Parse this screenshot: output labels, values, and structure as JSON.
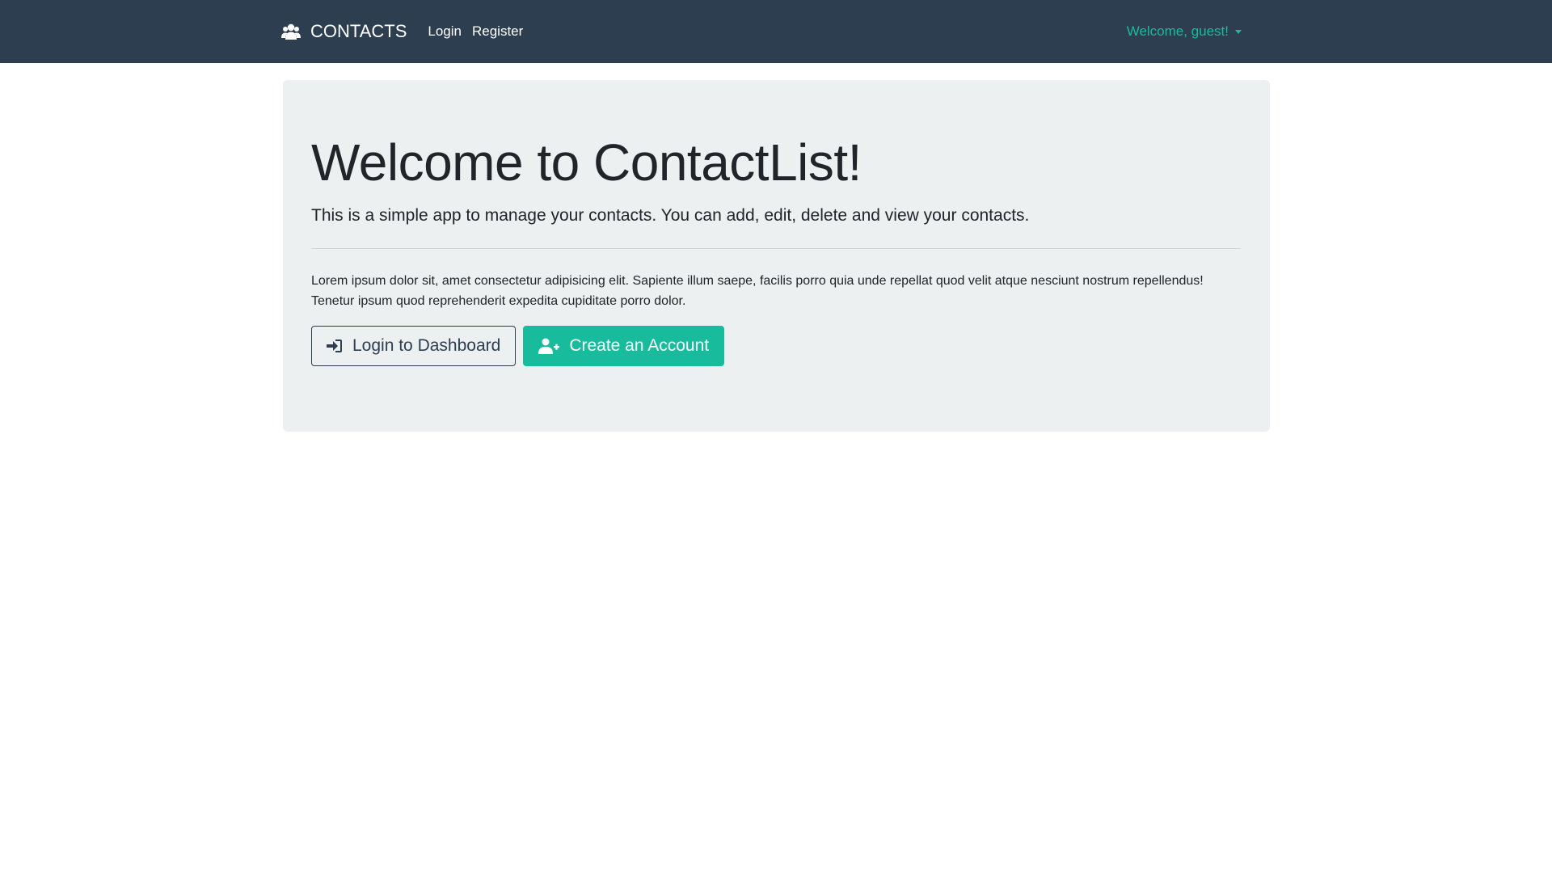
{
  "navbar": {
    "brand_label": "CONTACTS",
    "brand_icon": "users-icon",
    "links": [
      {
        "label": "Login"
      },
      {
        "label": "Register"
      }
    ],
    "user_menu_label": "Welcome, guest!"
  },
  "jumbotron": {
    "title": "Welcome to ContactList!",
    "lead": "This is a simple app to manage your contacts. You can add, edit, delete and view your contacts.",
    "body": "Lorem ipsum dolor sit, amet consectetur adipisicing elit. Sapiente illum saepe, facilis porro quia unde repellat quod velit atque nesciunt nostrum repellendus! Tenetur ipsum quod reprehenderit expedita cupiditate porro dolor.",
    "login_button_label": "Login to Dashboard",
    "login_button_icon": "sign-in-icon",
    "register_button_label": "Create an Account",
    "register_button_icon": "user-plus-icon"
  },
  "colors": {
    "navbar_bg": "#2c3e50",
    "accent": "#18bc9c",
    "jumbotron_bg": "#ecf0f1"
  }
}
